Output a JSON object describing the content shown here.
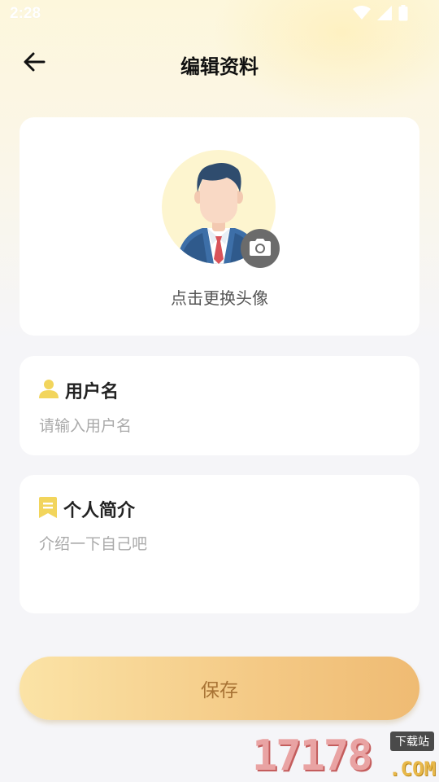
{
  "status_bar": {
    "time": "2:28",
    "icons": [
      "wifi-icon",
      "signal-icon",
      "battery-icon"
    ]
  },
  "header": {
    "title": "编辑资料",
    "back_icon": "arrow-left-icon"
  },
  "avatar_section": {
    "hint": "点击更换头像",
    "camera_icon": "camera-icon"
  },
  "username": {
    "label": "用户名",
    "icon": "user-icon",
    "value": "",
    "placeholder": "请输入用户名"
  },
  "bio": {
    "label": "个人简介",
    "icon": "bookmark-icon",
    "value": "",
    "placeholder": "介绍一下自己吧"
  },
  "save_label": "保存",
  "watermark": {
    "number": "17178",
    "site_label": "下载站",
    "suffix": ".COM"
  },
  "colors": {
    "accent_gold": "#efbb73",
    "icon_yellow": "#f2d55c",
    "save_text": "#a87334",
    "background": "#f5f5f8"
  }
}
